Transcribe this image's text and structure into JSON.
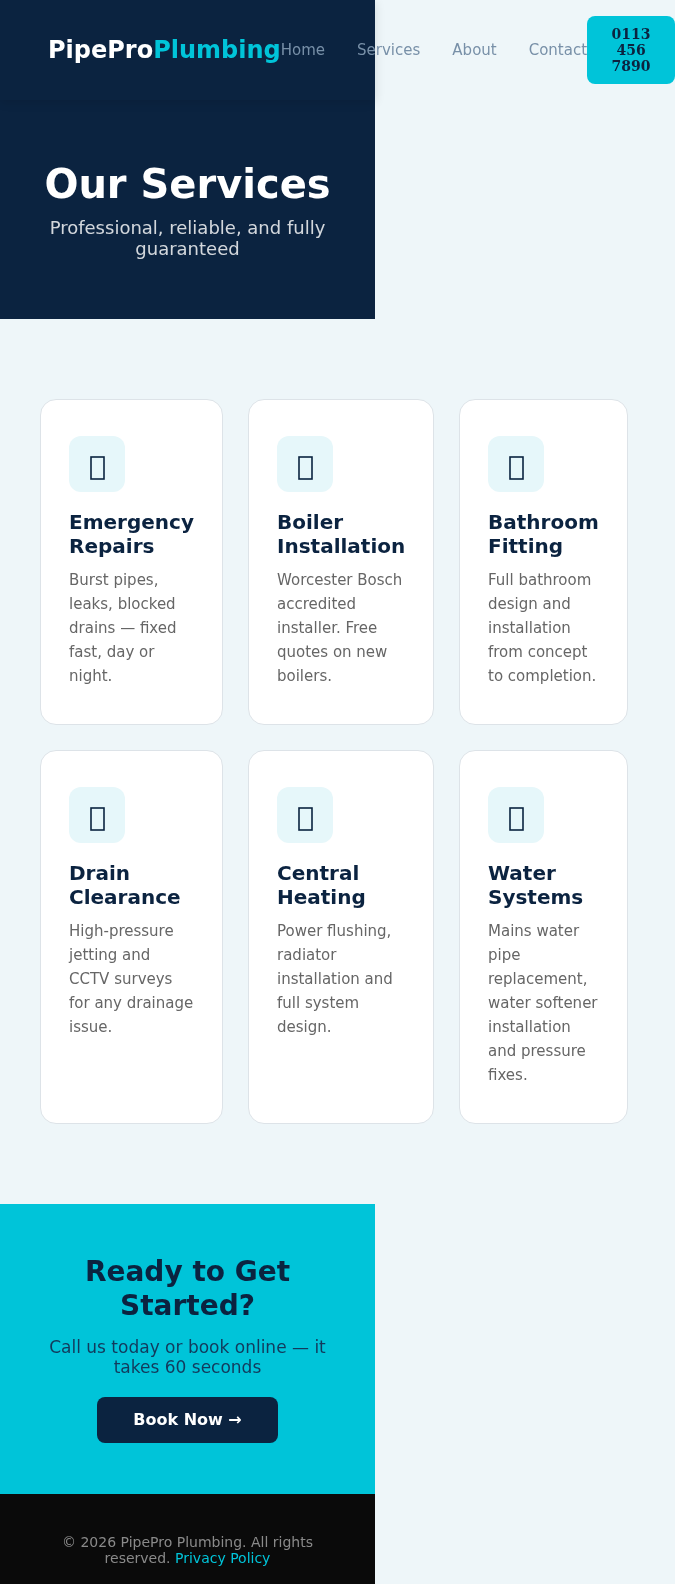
{
  "header": {
    "logo": {
      "main": "PipePro",
      "accent": "Plumbing"
    },
    "nav": [
      "Home",
      "Services",
      "About",
      "Contact"
    ],
    "phone_button": "0113 456 7890"
  },
  "hero": {
    "title": "Our Services",
    "subtitle": "Professional, reliable, and fully guaranteed"
  },
  "services": [
    {
      "title": "Emergency Repairs",
      "description": "Burst pipes, leaks, blocked drains — fixed fast, day or night."
    },
    {
      "title": "Boiler Installation",
      "description": "Worcester Bosch accredited installer. Free quotes on new boilers."
    },
    {
      "title": "Bathroom Fitting",
      "description": "Full bathroom design and installation from concept to completion."
    },
    {
      "title": "Drain Clearance",
      "description": "High-pressure jetting and CCTV surveys for any drainage issue."
    },
    {
      "title": "Central Heating",
      "description": "Power flushing, radiator installation and full system design."
    },
    {
      "title": "Water Systems",
      "description": "Mains water pipe replacement, water softener installation and pressure fixes."
    }
  ],
  "cta": {
    "title": "Ready to Get Started?",
    "subtitle": "Call us today or book online — it takes 60 seconds",
    "button": "Book Now →"
  },
  "footer": {
    "text": "© 2026 PipePro Plumbing. All rights reserved.",
    "link": "Privacy Policy"
  }
}
